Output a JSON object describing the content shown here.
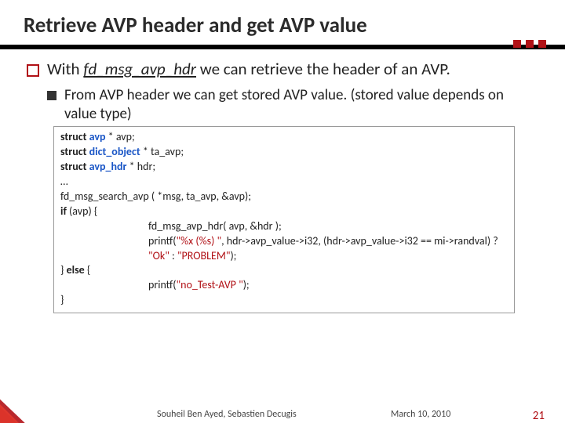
{
  "title": "Retrieve AVP header and get AVP value",
  "bullet1": {
    "pre": "With ",
    "emph": "fd_msg_avp_hdr",
    "post": " we can retrieve the header of an AVP."
  },
  "bullet2": "From AVP header we can get stored AVP value. (stored value depends on value type)",
  "code": {
    "l1_kw": "struct",
    "l1_ty": "avp",
    "l1_rest": " * avp;",
    "l2_kw": "struct",
    "l2_ty": "dict_object",
    "l2_rest": " * ta_avp;",
    "l3_kw": "struct",
    "l3_ty": "avp_hdr",
    "l3_rest": " * hdr;",
    "l4": "…",
    "l5": "fd_msg_search_avp ( *msg, ta_avp, &avp);",
    "l6_kw": "if",
    "l6_rest": " (avp) {",
    "l7": "fd_msg_avp_hdr( avp, &hdr );",
    "l8a": "printf(",
    "l8str": "\"%x (%s) \"",
    "l8b": ", hdr->avp_value->i32, (hdr->avp_value->i32 == mi->randval) ? ",
    "l8ok": "\"Ok\"",
    "l8c": " : ",
    "l8pr": "\"PROBLEM\"",
    "l8d": ");",
    "l9a": "} ",
    "l9_kw": "else",
    "l9b": " {",
    "l10a": "printf(",
    "l10str": "\"no_Test-AVP \"",
    "l10b": ");",
    "l11": "}"
  },
  "footer": {
    "author": "Souheil Ben Ayed, Sebastien Decugis",
    "date": "March 10, 2010",
    "page": "21"
  }
}
